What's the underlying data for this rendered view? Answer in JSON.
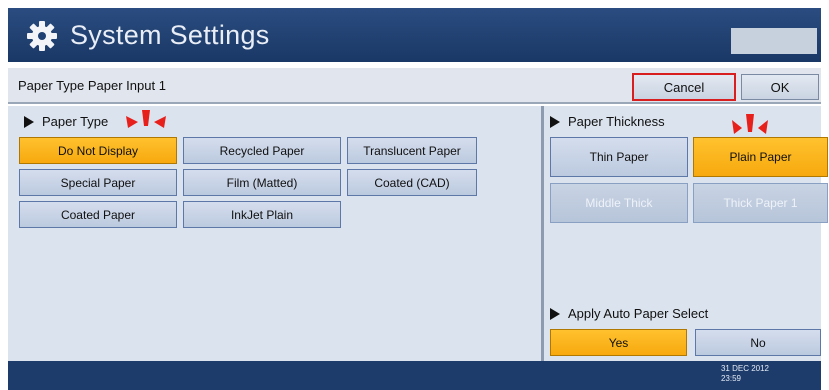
{
  "header": {
    "title": "System Settings",
    "icon": "gear-icon"
  },
  "subbar": {
    "title": "Paper Type Paper Input 1",
    "cancel_label": "Cancel",
    "ok_label": "OK"
  },
  "paper_type": {
    "label": "Paper Type",
    "options": [
      {
        "label": "Do Not Display",
        "selected": true
      },
      {
        "label": "Recycled Paper",
        "selected": false
      },
      {
        "label": "Translucent Paper",
        "selected": false
      },
      {
        "label": "Special Paper",
        "selected": false
      },
      {
        "label": "Film (Matted)",
        "selected": false
      },
      {
        "label": "Coated (CAD)",
        "selected": false
      },
      {
        "label": "Coated Paper",
        "selected": false
      },
      {
        "label": "InkJet Plain",
        "selected": false
      }
    ]
  },
  "paper_thickness": {
    "label": "Paper Thickness",
    "options": [
      {
        "label": "Thin Paper",
        "selected": false,
        "enabled": true
      },
      {
        "label": "Plain Paper",
        "selected": true,
        "enabled": true
      },
      {
        "label": "Middle Thick",
        "selected": false,
        "enabled": false
      },
      {
        "label": "Thick Paper 1",
        "selected": false,
        "enabled": false
      }
    ]
  },
  "auto_paper_select": {
    "label": "Apply Auto Paper Select",
    "yes_label": "Yes",
    "no_label": "No",
    "selected": "Yes"
  },
  "footer": {
    "date": "31 DEC 2012",
    "time": "23:59"
  },
  "colors": {
    "header_bg": "#1f4073",
    "selected": "#f7b11b",
    "button_bg": "#c8d4e6",
    "highlight": "#d81e1e"
  }
}
